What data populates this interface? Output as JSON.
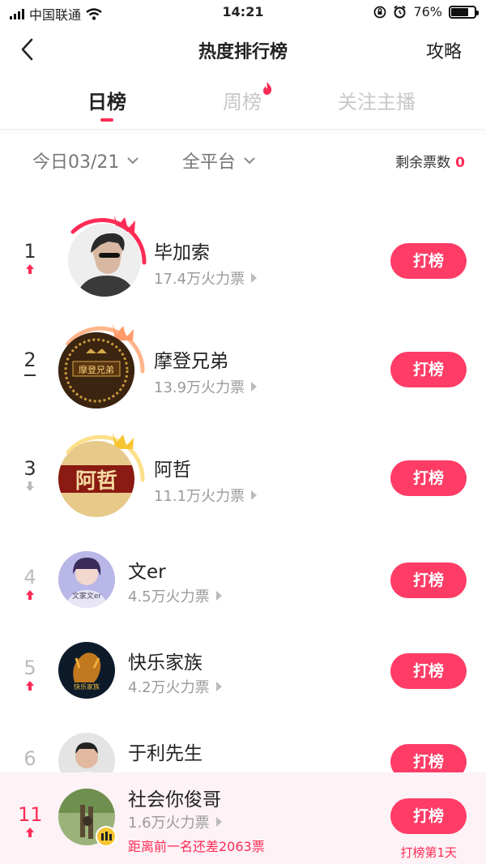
{
  "status_bar": {
    "carrier": "中国联通",
    "time": "14:21",
    "battery": "76%",
    "battery_level": 0.76
  },
  "nav": {
    "title": "热度排行榜",
    "right": "攻略"
  },
  "tabs": [
    {
      "label": "日榜",
      "active": true
    },
    {
      "label": "周榜",
      "active": false,
      "badge": "fire-icon"
    },
    {
      "label": "关注主播",
      "active": false
    }
  ],
  "filters": {
    "date": "今日03/21",
    "platform": "全平台",
    "remaining_label": "剩余票数",
    "remaining_value": "0"
  },
  "action_label": "打榜",
  "ranking": [
    {
      "rank": "1",
      "name": "毕加索",
      "votes": "17.4万火力票",
      "trend": "up"
    },
    {
      "rank": "2",
      "name": "摩登兄弟",
      "votes": "13.9万火力票",
      "trend": "same"
    },
    {
      "rank": "3",
      "name": "阿哲",
      "votes": "11.1万火力票",
      "trend": "down"
    },
    {
      "rank": "4",
      "name": "文er",
      "votes": "4.5万火力票",
      "trend": "up"
    },
    {
      "rank": "5",
      "name": "快乐家族",
      "votes": "4.2万火力票",
      "trend": "up"
    },
    {
      "rank": "6",
      "name": "于利先生",
      "votes": "",
      "trend": ""
    }
  ],
  "avatar_text": {
    "r2": "摩登兄弟",
    "r3": "阿哲",
    "r4": "文家文er",
    "r5": "快乐家族"
  },
  "my_rank": {
    "rank": "11",
    "name": "社会你俊哥",
    "votes": "1.6万火力票",
    "gap_text": "距离前一名还差2063票",
    "days_text": "打榜第1天",
    "trend": "up"
  },
  "colors": {
    "accent": "#fe2c55",
    "button": "#fe3c66",
    "gold": "#f7c531"
  }
}
